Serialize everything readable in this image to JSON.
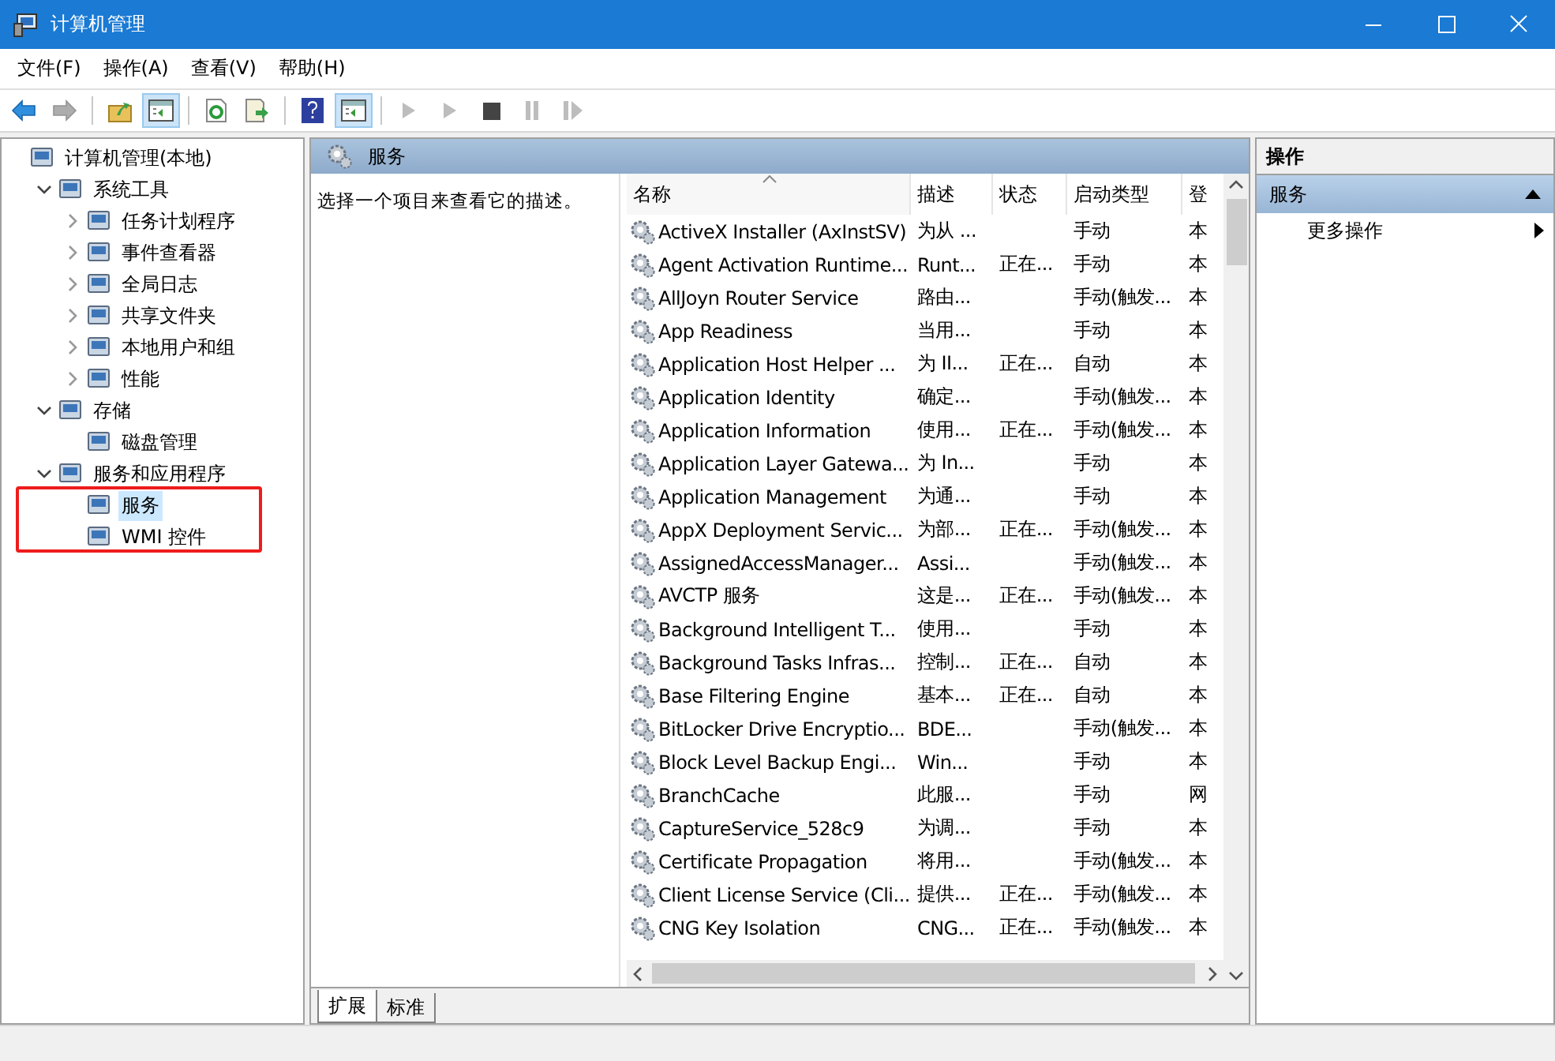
{
  "window": {
    "title": "计算机管理"
  },
  "menu": [
    "文件(F)",
    "操作(A)",
    "查看(V)",
    "帮助(H)"
  ],
  "toolbar": [
    {
      "kind": "back",
      "disabled": false,
      "pressed": false
    },
    {
      "kind": "forward",
      "disabled": true,
      "pressed": false
    },
    {
      "kind": "sep"
    },
    {
      "kind": "up",
      "disabled": false,
      "pressed": false
    },
    {
      "kind": "pane",
      "disabled": false,
      "pressed": true
    },
    {
      "kind": "sep"
    },
    {
      "kind": "refresh",
      "disabled": false,
      "pressed": false
    },
    {
      "kind": "export",
      "disabled": false,
      "pressed": false
    },
    {
      "kind": "sep"
    },
    {
      "kind": "help",
      "disabled": false,
      "pressed": false
    },
    {
      "kind": "pane",
      "disabled": false,
      "pressed": true
    },
    {
      "kind": "sep"
    },
    {
      "kind": "play",
      "disabled": true,
      "pressed": false
    },
    {
      "kind": "play",
      "disabled": true,
      "pressed": false
    },
    {
      "kind": "stop",
      "disabled": false,
      "pressed": false
    },
    {
      "kind": "pause",
      "disabled": true,
      "pressed": false
    },
    {
      "kind": "resume",
      "disabled": true,
      "pressed": false
    }
  ],
  "tree": [
    {
      "label": "计算机管理(本地)",
      "selected": false,
      "children": [
        {
          "label": "系统工具",
          "expanded": true,
          "selected": false,
          "children": [
            {
              "label": "任务计划程序",
              "expanded": false,
              "selected": false
            },
            {
              "label": "事件查看器",
              "expanded": false,
              "selected": false
            },
            {
              "label": "全局日志",
              "expanded": false,
              "selected": false
            },
            {
              "label": "共享文件夹",
              "expanded": false,
              "selected": false
            },
            {
              "label": "本地用户和组",
              "expanded": false,
              "selected": false
            },
            {
              "label": "性能",
              "expanded": false,
              "selected": false
            }
          ]
        },
        {
          "label": "存储",
          "expanded": true,
          "selected": false,
          "children": [
            {
              "label": "磁盘管理",
              "selected": false
            }
          ]
        },
        {
          "label": "服务和应用程序",
          "expanded": true,
          "selected": false,
          "children": [
            {
              "label": "服务",
              "selected": true
            },
            {
              "label": "WMI 控件",
              "selected": false
            }
          ]
        }
      ]
    }
  ],
  "center": {
    "header": "服务",
    "description": "选择一个项目来查看它的描述。",
    "columns": [
      {
        "label": "名称",
        "sorted": true
      },
      {
        "label": "描述",
        "sorted": false
      },
      {
        "label": "状态",
        "sorted": false
      },
      {
        "label": "启动类型",
        "sorted": false
      },
      {
        "label": "登",
        "sorted": false
      }
    ],
    "rows": [
      [
        "ActiveX Installer (AxInstSV)",
        "为从 ...",
        "",
        "手动",
        "本"
      ],
      [
        "Agent Activation Runtime...",
        "Runt...",
        "正在...",
        "手动",
        "本"
      ],
      [
        "AllJoyn Router Service",
        "路由...",
        "",
        "手动(触发...",
        "本"
      ],
      [
        "App Readiness",
        "当用...",
        "",
        "手动",
        "本"
      ],
      [
        "Application Host Helper ...",
        "为 II...",
        "正在...",
        "自动",
        "本"
      ],
      [
        "Application Identity",
        "确定...",
        "",
        "手动(触发...",
        "本"
      ],
      [
        "Application Information",
        "使用...",
        "正在...",
        "手动(触发...",
        "本"
      ],
      [
        "Application Layer Gatewa...",
        "为 In...",
        "",
        "手动",
        "本"
      ],
      [
        "Application Management",
        "为通...",
        "",
        "手动",
        "本"
      ],
      [
        "AppX Deployment Servic...",
        "为部...",
        "正在...",
        "手动(触发...",
        "本"
      ],
      [
        "AssignedAccessManager...",
        "Assi...",
        "",
        "手动(触发...",
        "本"
      ],
      [
        "AVCTP 服务",
        "这是...",
        "正在...",
        "手动(触发...",
        "本"
      ],
      [
        "Background Intelligent T...",
        "使用...",
        "",
        "手动",
        "本"
      ],
      [
        "Background Tasks Infras...",
        "控制...",
        "正在...",
        "自动",
        "本"
      ],
      [
        "Base Filtering Engine",
        "基本...",
        "正在...",
        "自动",
        "本"
      ],
      [
        "BitLocker Drive Encryptio...",
        "BDE...",
        "",
        "手动(触发...",
        "本"
      ],
      [
        "Block Level Backup Engi...",
        "Win...",
        "",
        "手动",
        "本"
      ],
      [
        "BranchCache",
        "此服...",
        "",
        "手动",
        "网"
      ],
      [
        "CaptureService_528c9",
        "为调...",
        "",
        "手动",
        "本"
      ],
      [
        "Certificate Propagation",
        "将用...",
        "",
        "手动(触发...",
        "本"
      ],
      [
        "Client License Service (Cli...",
        "提供...",
        "正在...",
        "手动(触发...",
        "本"
      ],
      [
        "CNG Key Isolation",
        "CNG...",
        "正在...",
        "手动(触发...",
        "本"
      ]
    ],
    "tabs": [
      {
        "label": "扩展",
        "selected": true
      },
      {
        "label": "标准",
        "selected": false
      }
    ]
  },
  "actions": {
    "header": "操作",
    "section": {
      "label": "服务",
      "expanded": true
    },
    "items": [
      "更多操作"
    ]
  }
}
